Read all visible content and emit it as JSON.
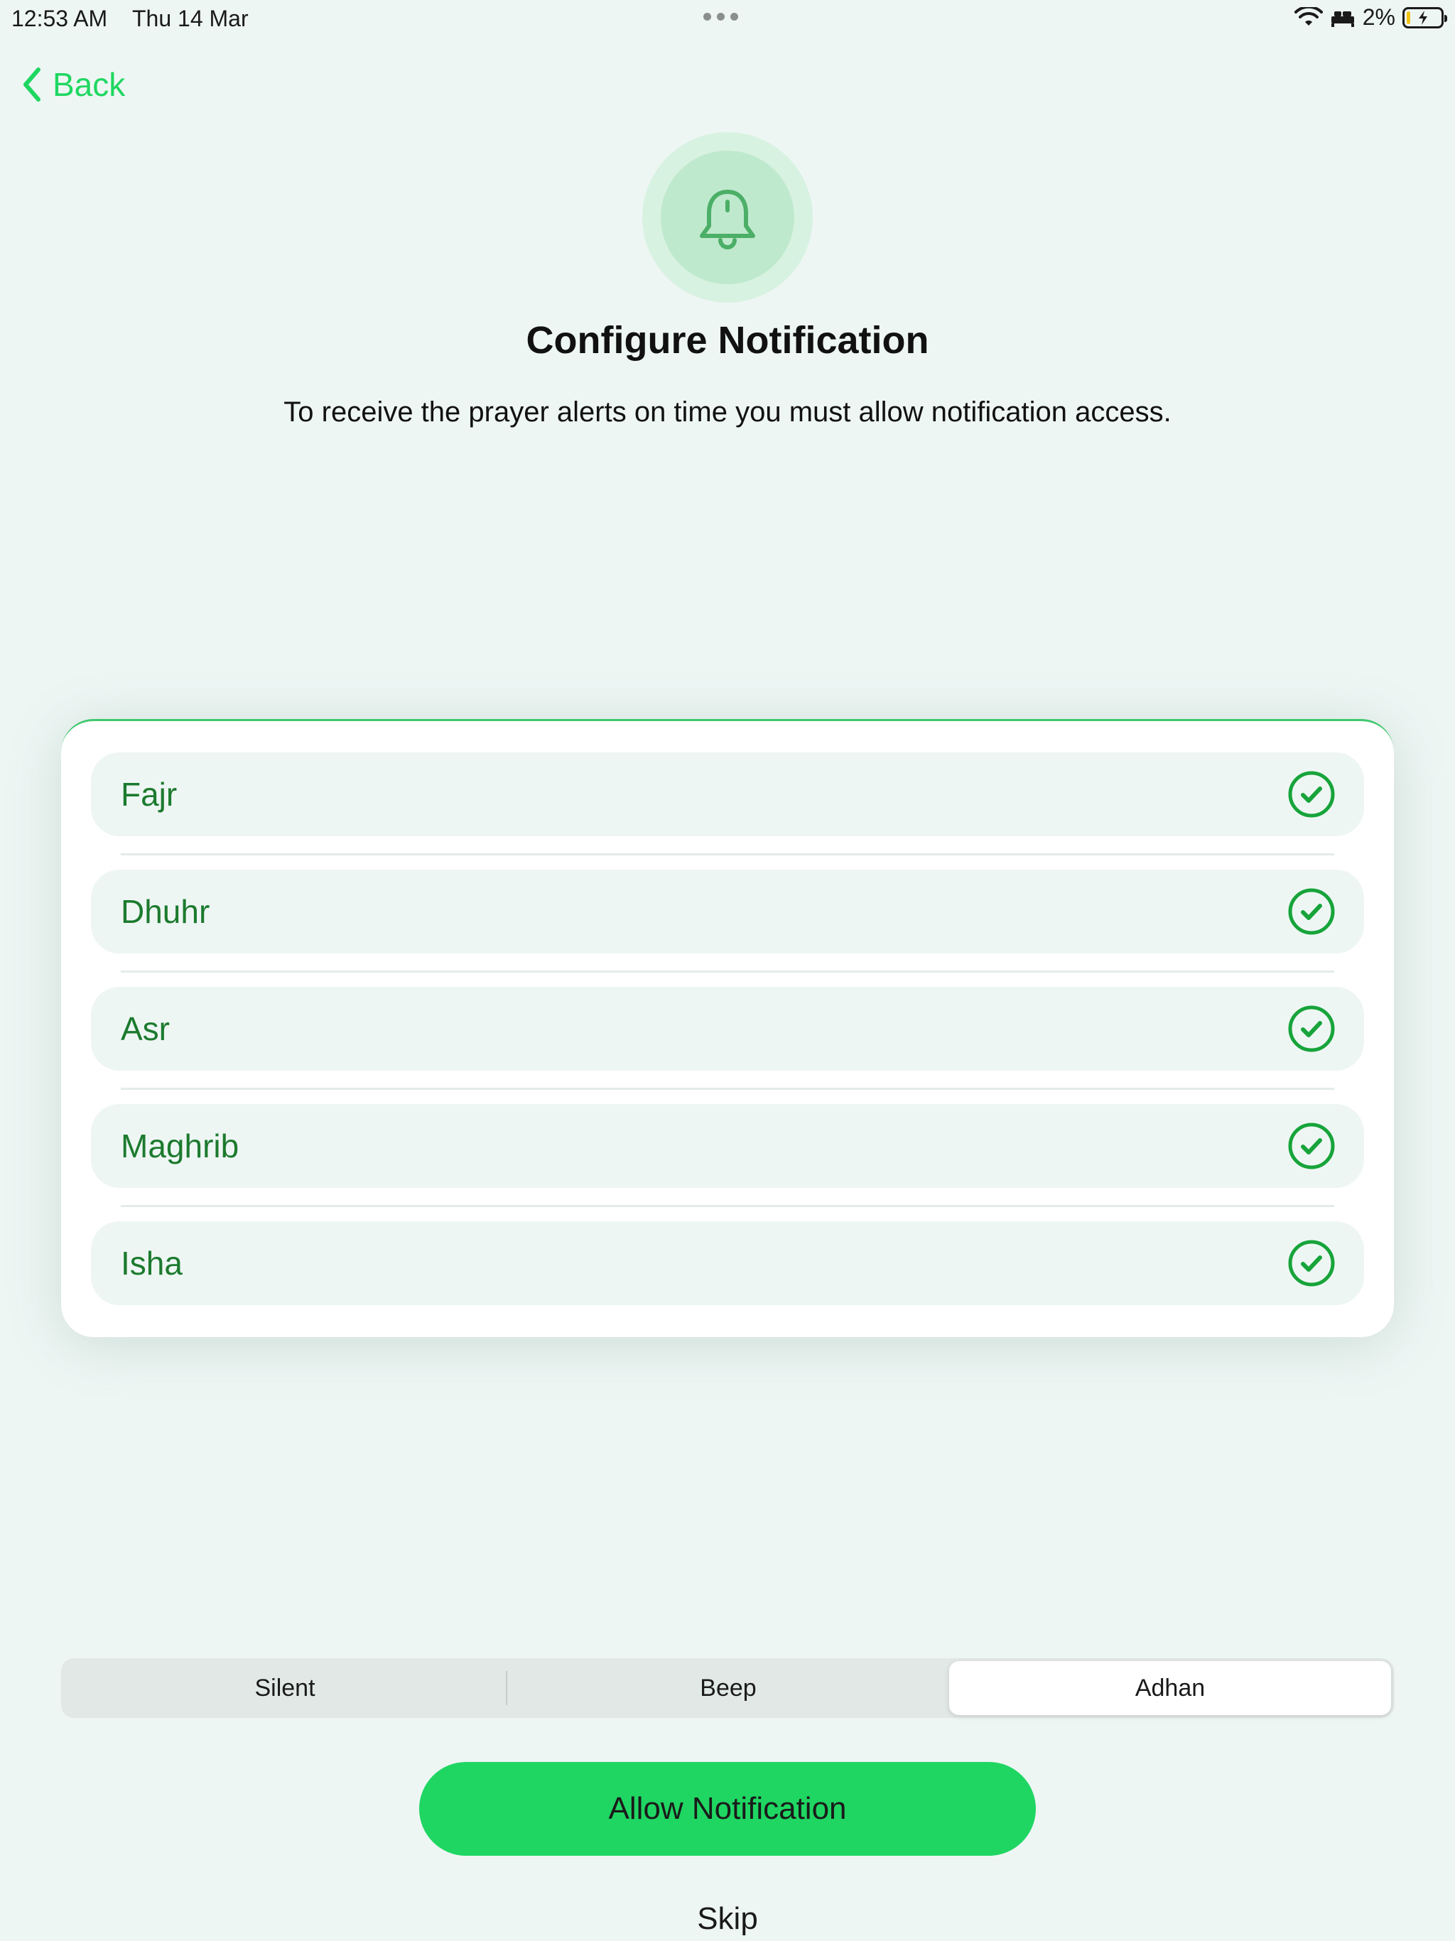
{
  "status_bar": {
    "time": "12:53 AM",
    "date": "Thu 14 Mar",
    "battery_percent": "2%",
    "icons": [
      "wifi-icon",
      "bed-icon",
      "battery-charging-icon"
    ]
  },
  "nav": {
    "back_label": "Back"
  },
  "header": {
    "icon": "bell-icon",
    "title": "Configure Notification",
    "subtitle": "To receive the prayer alerts on time you must allow notification access."
  },
  "prayers": [
    {
      "label": "Fajr",
      "checked": true
    },
    {
      "label": "Dhuhr",
      "checked": true
    },
    {
      "label": "Asr",
      "checked": true
    },
    {
      "label": "Maghrib",
      "checked": true
    },
    {
      "label": "Isha",
      "checked": true
    }
  ],
  "sound_mode": {
    "options": [
      "Silent",
      "Beep",
      "Adhan"
    ],
    "selected": "Adhan"
  },
  "actions": {
    "allow_label": "Allow Notification",
    "skip_label": "Skip"
  },
  "colors": {
    "accent": "#1fd662",
    "prayer_text": "#1c7a2e",
    "check": "#17a43a",
    "background": "#eef6f4"
  }
}
